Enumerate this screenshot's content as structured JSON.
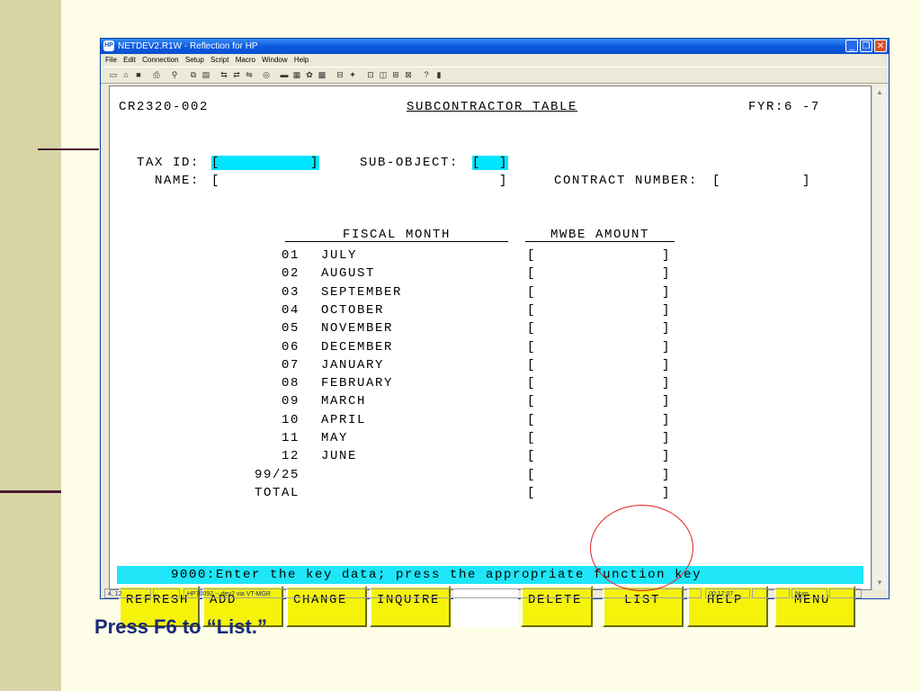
{
  "slide": {
    "caption": "Press F6 to “List.”"
  },
  "window": {
    "title": "NETDEV2.R1W - Reflection for HP",
    "app_icon": "HP",
    "controls": {
      "minimize": "_",
      "maximize": "❐",
      "close": "✕"
    }
  },
  "menu": [
    "File",
    "Edit",
    "Connection",
    "Setup",
    "Script",
    "Macro",
    "Window",
    "Help"
  ],
  "toolbar_icons": [
    "new-icon",
    "open-icon",
    "save-icon",
    "print-icon",
    "find-icon",
    "copy-icon",
    "paste-icon",
    "connect-icon",
    "transfer-icon",
    "transfer2-icon",
    "record-icon",
    "keyboard-icon",
    "screen-icon",
    "settings-icon",
    "display-icon",
    "printer-icon",
    "macro-icon",
    "terminal-icon",
    "hotspot-icon",
    "window-icon",
    "exit-icon",
    "help-icon",
    "book-icon"
  ],
  "screen": {
    "form_id": "CR2320-002",
    "heading": "SUBCONTRACTOR TABLE",
    "fyr": "FYR:6 -7",
    "tax_id_label": "TAX ID:",
    "tax_id_value": "[          ]",
    "sub_object_label": "SUB-OBJECT:",
    "sub_object_value": "[  ]",
    "name_label": "NAME:",
    "name_value": "[                               ]",
    "contract_label": "CONTRACT NUMBER:",
    "contract_value": "[         ]",
    "col_fiscal_month": "FISCAL MONTH",
    "col_mwbe_amount": "MWBE AMOUNT",
    "months": [
      {
        "num": "01",
        "name": "JULY",
        "amount": "[              ]"
      },
      {
        "num": "02",
        "name": "AUGUST",
        "amount": "[              ]"
      },
      {
        "num": "03",
        "name": "SEPTEMBER",
        "amount": "[              ]"
      },
      {
        "num": "04",
        "name": "OCTOBER",
        "amount": "[              ]"
      },
      {
        "num": "05",
        "name": "NOVEMBER",
        "amount": "[              ]"
      },
      {
        "num": "06",
        "name": "DECEMBER",
        "amount": "[              ]"
      },
      {
        "num": "07",
        "name": "JANUARY",
        "amount": "[              ]"
      },
      {
        "num": "08",
        "name": "FEBRUARY",
        "amount": "[              ]"
      },
      {
        "num": "09",
        "name": "MARCH",
        "amount": "[              ]"
      },
      {
        "num": "10",
        "name": "APRIL",
        "amount": "[              ]"
      },
      {
        "num": "11",
        "name": "MAY",
        "amount": "[              ]"
      },
      {
        "num": "12",
        "name": "JUNE",
        "amount": "[              ]"
      },
      {
        "num": "99/25",
        "name": "",
        "amount": "[              ]"
      },
      {
        "num": "TOTAL",
        "name": "",
        "amount": "[              ]"
      }
    ],
    "status_message": "9000:Enter the key data; press the appropriate function key",
    "function_keys": [
      "REFRESH",
      "ADD",
      "CHANGE",
      "INQUIRE",
      "",
      "DELETE",
      "LIST",
      "HELP",
      "MENU"
    ]
  },
  "statusbar": {
    "cursor": "4, 12",
    "connection": "HP70092 -- dev2 via VT-MGR",
    "time": "00:17:07",
    "num": "Num"
  },
  "colors": {
    "status_bg": "#1ee6f8",
    "fkey_bg": "#f5f30a",
    "field_highlight": "#00e5ff",
    "annotation_circle": "#e02020",
    "caption": "#1a2a7a"
  }
}
